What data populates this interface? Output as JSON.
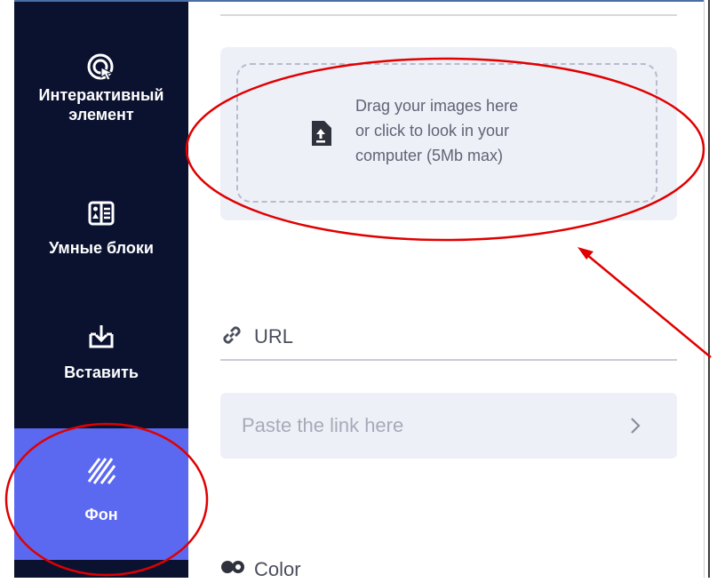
{
  "sidebar": {
    "items": [
      {
        "label": "Интерактивный\nэлемент",
        "icon": "cursor-click-icon"
      },
      {
        "label": "Умные блоки",
        "icon": "smart-blocks-icon"
      },
      {
        "label": "Вставить",
        "icon": "insert-icon"
      },
      {
        "label": "Фон",
        "icon": "background-stripes-icon",
        "active": true
      }
    ]
  },
  "upload": {
    "text": "Drag your images here\nor click to look in your\ncomputer (5Mb max)",
    "icon": "upload-file-icon"
  },
  "url": {
    "label": "URL",
    "placeholder": "Paste the link here",
    "icon": "link-icon"
  },
  "color": {
    "label": "Color",
    "icon": "palette-icon"
  },
  "colors": {
    "sidebar_bg": "#0b1230",
    "sidebar_active": "#5b68f0",
    "field_bg": "#eef0f8",
    "annotation": "#e00000"
  }
}
